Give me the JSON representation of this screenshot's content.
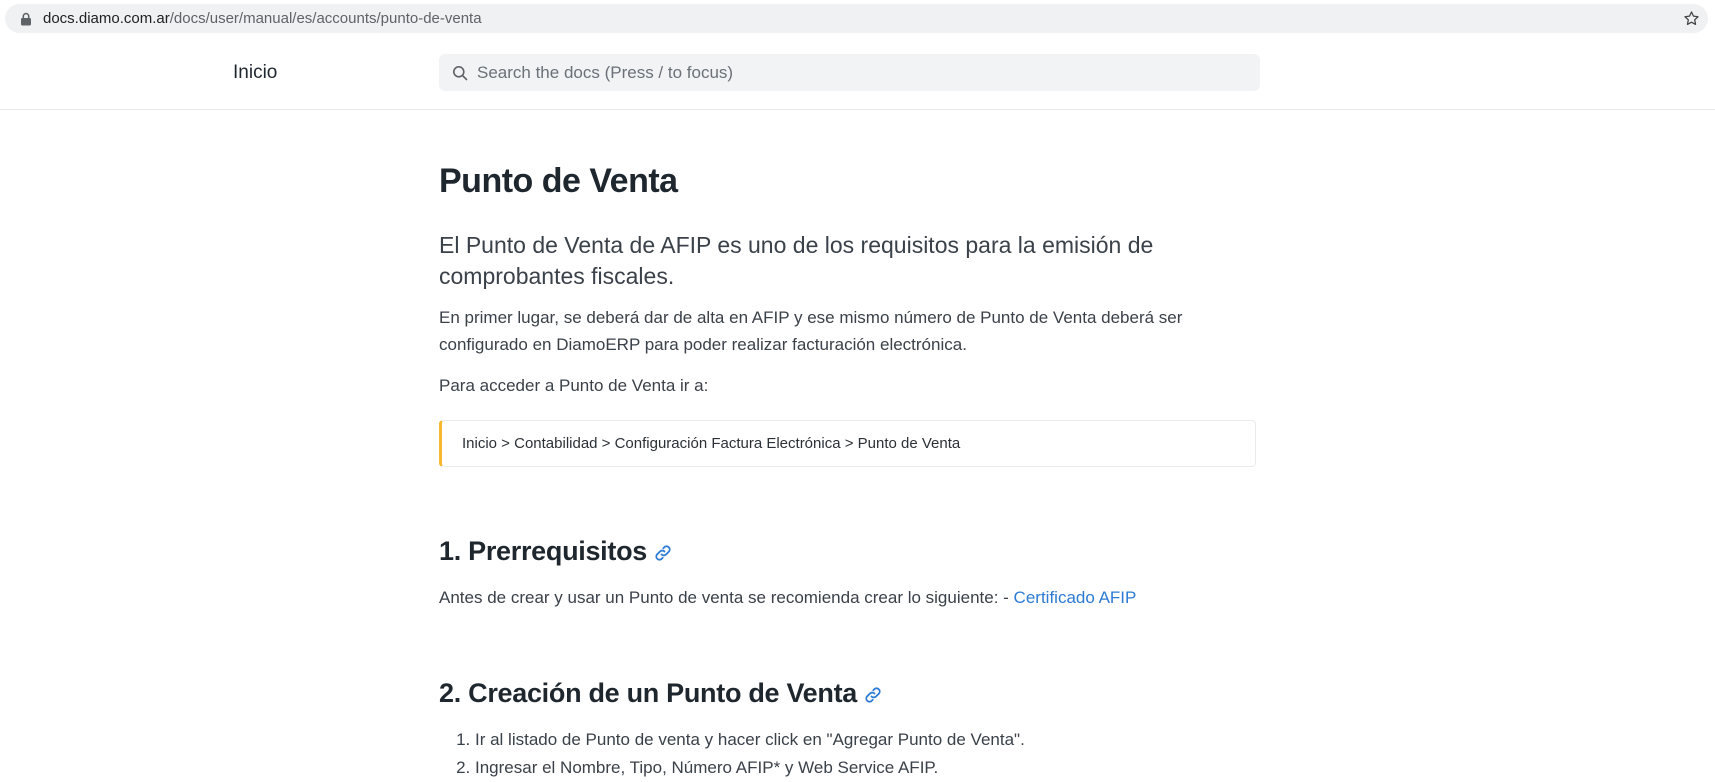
{
  "browser": {
    "url_host": "docs.diamo.com.ar",
    "url_path": "/docs/user/manual/es/accounts/punto-de-venta"
  },
  "navbar": {
    "brand": "Inicio",
    "search_placeholder": "Search the docs (Press / to focus)"
  },
  "page": {
    "title": "Punto de Venta",
    "lead": "El Punto de Venta de AFIP es uno de los requisitos para la emisión de comprobantes fiscales.",
    "intro": "En primer lugar, se deberá dar de alta en AFIP y ese mismo número de Punto de Venta deberá ser configurado en DiamoERP para poder realizar facturación electrónica.",
    "access_text": "Para acceder a Punto de Venta ir a:",
    "callout": "Inicio > Contabilidad > Configuración Factura Electrónica > Punto de Venta",
    "section1": {
      "heading": "1. Prerrequisitos",
      "text": "Antes de crear y usar un Punto de venta se recomienda crear lo siguiente: - ",
      "link": "Certificado AFIP"
    },
    "section2": {
      "heading": "2. Creación de un Punto de Venta",
      "steps": [
        "Ir al listado de Punto de venta y hacer click en \"Agregar Punto de Venta\".",
        "Ingresar el Nombre, Tipo, Número AFIP* y Web Service AFIP."
      ]
    }
  },
  "icons": {
    "lock": "lock-icon",
    "star": "bookmark-star-icon",
    "search": "search-icon",
    "anchor": "link-icon"
  },
  "colors": {
    "link": "#2d7bd4",
    "callout_accent": "#f5b82e"
  }
}
